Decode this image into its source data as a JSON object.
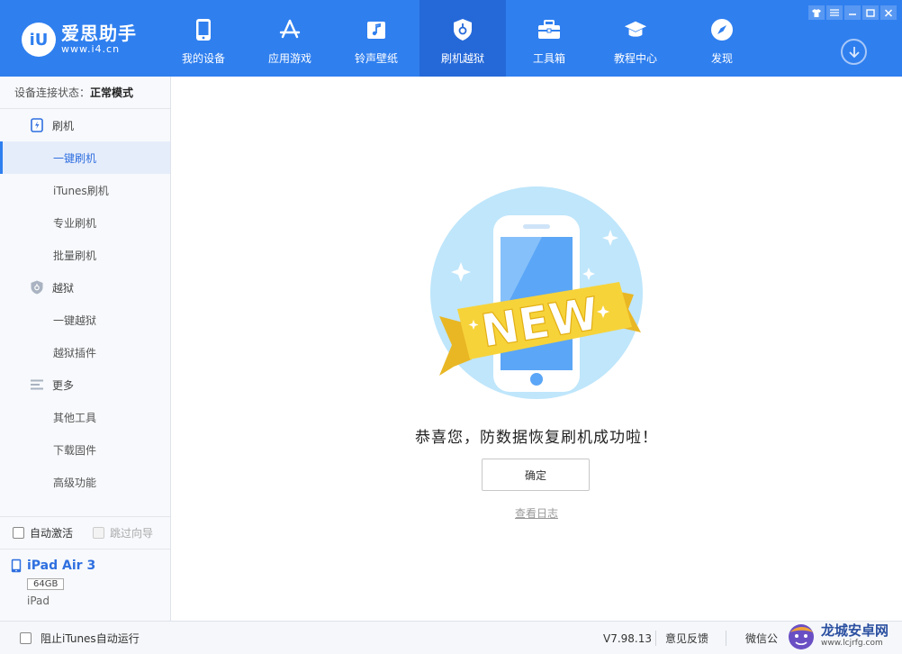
{
  "app": {
    "logo_mark": "iU",
    "name": "爱思助手",
    "url": "www.i4.cn"
  },
  "nav": {
    "items": [
      {
        "label": "我的设备",
        "icon": "phone-icon"
      },
      {
        "label": "应用游戏",
        "icon": "app-store-icon"
      },
      {
        "label": "铃声壁纸",
        "icon": "music-icon"
      },
      {
        "label": "刷机越狱",
        "icon": "shield-icon"
      },
      {
        "label": "工具箱",
        "icon": "toolbox-icon"
      },
      {
        "label": "教程中心",
        "icon": "graduation-cap-icon"
      },
      {
        "label": "发现",
        "icon": "compass-icon"
      }
    ],
    "active_index": 3
  },
  "sidebar": {
    "connection_label": "设备连接状态：",
    "connection_value": "正常模式",
    "groups": [
      {
        "label": "刷机",
        "icon": "flash-icon",
        "items": [
          "一键刷机",
          "iTunes刷机",
          "专业刷机",
          "批量刷机"
        ]
      },
      {
        "label": "越狱",
        "icon": "jailbreak-shield-icon",
        "items": [
          "一键越狱",
          "越狱插件"
        ]
      },
      {
        "label": "更多",
        "icon": "menu-lines-icon",
        "items": [
          "其他工具",
          "下载固件",
          "高级功能"
        ]
      }
    ],
    "active_item": "一键刷机",
    "auto_activate_label": "自动激活",
    "skip_guide_label": "跳过向导",
    "device": {
      "name": "iPad Air 3",
      "capacity": "64GB",
      "type": "iPad"
    }
  },
  "main": {
    "badge_text": "NEW",
    "success_message": "恭喜您，防数据恢复刷机成功啦！",
    "ok_button": "确定",
    "view_log_link": "查看日志"
  },
  "bottombar": {
    "itunes_label": "阻止iTunes自动运行",
    "version": "V7.98.13",
    "feedback": "意见反馈",
    "wechat": "微信公"
  },
  "watermark": {
    "title": "龙城安卓网",
    "url": "www.lcjrfg.com"
  },
  "colors": {
    "primary": "#2f7fef",
    "nav_active": "#2569d9",
    "badge_yellow": "#f7d33a"
  }
}
